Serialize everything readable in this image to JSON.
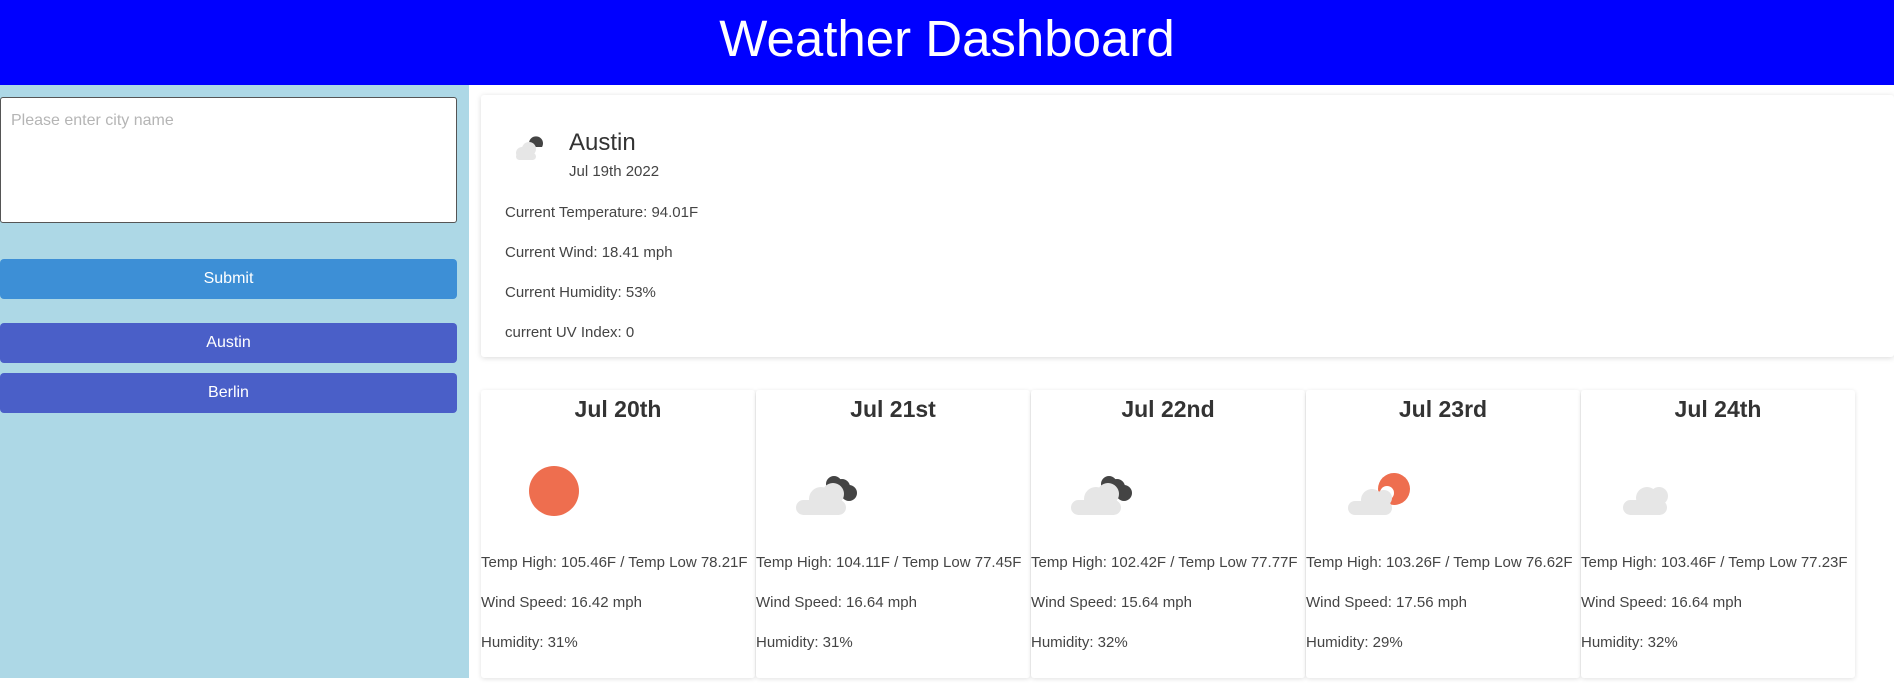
{
  "header": {
    "title": "Weather Dashboard"
  },
  "search": {
    "placeholder": "Please enter city name",
    "submit_label": "Submit"
  },
  "history": [
    "Austin",
    "Berlin"
  ],
  "current": {
    "city": "Austin",
    "date": "Jul 19th 2022",
    "icon": "partly-cloudy-night-icon",
    "temperature": "Current Temperature: 94.01F",
    "wind": "Current Wind: 18.41 mph",
    "humidity": "Current Humidity: 53%",
    "uv": "current UV Index: 0"
  },
  "forecast": [
    {
      "date": "Jul 20th",
      "icon": "sun-icon",
      "temp": "Temp High: 105.46F / Temp Low 78.21F",
      "wind": "Wind Speed: 16.42 mph",
      "humidity": "Humidity: 31%"
    },
    {
      "date": "Jul 21st",
      "icon": "cloudy-night-icon",
      "temp": "Temp High: 104.11F / Temp Low 77.45F",
      "wind": "Wind Speed: 16.64 mph",
      "humidity": "Humidity: 31%"
    },
    {
      "date": "Jul 22nd",
      "icon": "cloudy-night-icon",
      "temp": "Temp High: 102.42F / Temp Low 77.77F",
      "wind": "Wind Speed: 15.64 mph",
      "humidity": "Humidity: 32%"
    },
    {
      "date": "Jul 23rd",
      "icon": "partly-cloudy-sun-icon",
      "temp": "Temp High: 103.26F / Temp Low 76.62F",
      "wind": "Wind Speed: 17.56 mph",
      "humidity": "Humidity: 29%"
    },
    {
      "date": "Jul 24th",
      "icon": "cloud-icon",
      "temp": "Temp High: 103.46F / Temp Low 77.23F",
      "wind": "Wind Speed: 16.64 mph",
      "humidity": "Humidity: 32%"
    }
  ],
  "colors": {
    "header_bg": "#0000ff",
    "sidebar_bg": "#add8e6",
    "submit_bg": "#3d8fd6",
    "history_bg": "#4a5fc8",
    "sun": "#ee6e4f",
    "cloud_light": "#e6e6e6",
    "cloud_dark": "#444444"
  }
}
